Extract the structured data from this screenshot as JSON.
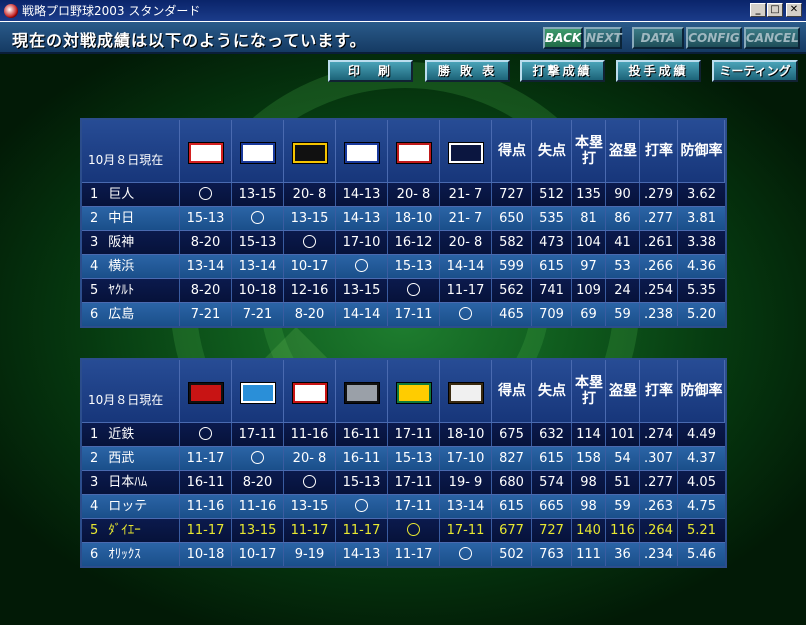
{
  "window": {
    "title": "戦略プロ野球2003 スタンダード"
  },
  "header": {
    "message": "現在の対戦成績は以下のようになっています。",
    "nav": {
      "back": "BACK",
      "next": "NEXT",
      "data": "DATA",
      "config": "CONFIG",
      "cancel": "CANCEL"
    }
  },
  "commands": {
    "print": "印　刷",
    "wins_losses": "勝 敗 表",
    "batting": "打撃成績",
    "pitching": "投手成績",
    "meeting": "ミーティング"
  },
  "stat_headers": [
    "得点",
    "失点",
    "本塁打",
    "盗塁",
    "打率",
    "防御率"
  ],
  "central": {
    "date_label": "10月８日現在",
    "teams": [
      {
        "rank": "1",
        "name": "巨人",
        "vs": [
          "",
          "13-15",
          "20- 8",
          "14-13",
          "20- 8",
          "21- 7"
        ],
        "runs": "727",
        "allowed": "512",
        "hr": "135",
        "sb": "90",
        "avg": ".279",
        "era": "3.62"
      },
      {
        "rank": "2",
        "name": "中日",
        "vs": [
          "15-13",
          "",
          "13-15",
          "14-13",
          "18-10",
          "21- 7"
        ],
        "runs": "650",
        "allowed": "535",
        "hr": "81",
        "sb": "86",
        "avg": ".277",
        "era": "3.81"
      },
      {
        "rank": "3",
        "name": "阪神",
        "vs": [
          "8-20",
          "15-13",
          "",
          "17-10",
          "16-12",
          "20- 8"
        ],
        "runs": "582",
        "allowed": "473",
        "hr": "104",
        "sb": "41",
        "avg": ".261",
        "era": "3.38"
      },
      {
        "rank": "4",
        "name": "横浜",
        "vs": [
          "13-14",
          "13-14",
          "10-17",
          "",
          "15-13",
          "14-14"
        ],
        "runs": "599",
        "allowed": "615",
        "hr": "97",
        "sb": "53",
        "avg": ".266",
        "era": "4.36"
      },
      {
        "rank": "5",
        "name": "ﾔｸﾙﾄ",
        "vs": [
          "8-20",
          "10-18",
          "12-16",
          "13-15",
          "",
          "11-17"
        ],
        "runs": "562",
        "allowed": "741",
        "hr": "109",
        "sb": "24",
        "avg": ".254",
        "era": "5.35"
      },
      {
        "rank": "6",
        "name": "広島",
        "vs": [
          "7-21",
          "7-21",
          "8-20",
          "14-14",
          "17-11",
          ""
        ],
        "runs": "465",
        "allowed": "709",
        "hr": "69",
        "sb": "59",
        "avg": ".238",
        "era": "5.20"
      }
    ],
    "logos": [
      {
        "icon": "giants-logo-icon",
        "bg": "#ffffff",
        "fg": "#d32020",
        "mark": "G"
      },
      {
        "icon": "dragons-logo-icon",
        "bg": "#ffffff",
        "fg": "#1a3a9c",
        "mark": "D"
      },
      {
        "icon": "tigers-logo-icon",
        "bg": "#111111",
        "fg": "#f5c400",
        "mark": "T"
      },
      {
        "icon": "baystars-logo-icon",
        "bg": "#ffffff",
        "fg": "#1a3a9c",
        "mark": "B"
      },
      {
        "icon": "swallows-logo-icon",
        "bg": "#ffffff",
        "fg": "#c01a1a",
        "mark": "S"
      },
      {
        "icon": "carp-logo-icon",
        "bg": "#0b1640",
        "fg": "#ffffff",
        "mark": "H"
      }
    ]
  },
  "pacific": {
    "date_label": "10月８日現在",
    "teams": [
      {
        "rank": "1",
        "name": "近鉄",
        "vs": [
          "",
          "17-11",
          "11-16",
          "16-11",
          "17-11",
          "18-10"
        ],
        "runs": "675",
        "allowed": "632",
        "hr": "114",
        "sb": "101",
        "avg": ".274",
        "era": "4.49",
        "highlight": false
      },
      {
        "rank": "2",
        "name": "西武",
        "vs": [
          "11-17",
          "",
          "20- 8",
          "16-11",
          "15-13",
          "17-10"
        ],
        "runs": "827",
        "allowed": "615",
        "hr": "158",
        "sb": "54",
        "avg": ".307",
        "era": "4.37",
        "highlight": false
      },
      {
        "rank": "3",
        "name": "日本ﾊﾑ",
        "vs": [
          "16-11",
          "8-20",
          "",
          "15-13",
          "17-11",
          "19- 9"
        ],
        "runs": "680",
        "allowed": "574",
        "hr": "98",
        "sb": "51",
        "avg": ".277",
        "era": "4.05",
        "highlight": false
      },
      {
        "rank": "4",
        "name": "ロッテ",
        "vs": [
          "11-16",
          "11-16",
          "13-15",
          "",
          "17-11",
          "13-14"
        ],
        "runs": "615",
        "allowed": "665",
        "hr": "98",
        "sb": "59",
        "avg": ".263",
        "era": "4.75",
        "highlight": false
      },
      {
        "rank": "5",
        "name": "ﾀﾞｲｴｰ",
        "vs": [
          "11-17",
          "13-15",
          "11-17",
          "11-17",
          "",
          "17-11"
        ],
        "runs": "677",
        "allowed": "727",
        "hr": "140",
        "sb": "116",
        "avg": ".264",
        "era": "5.21",
        "highlight": true
      },
      {
        "rank": "6",
        "name": "ｵﾘｯｸｽ",
        "vs": [
          "10-18",
          "10-17",
          "9-19",
          "14-13",
          "11-17",
          ""
        ],
        "runs": "502",
        "allowed": "763",
        "hr": "111",
        "sb": "36",
        "avg": ".234",
        "era": "5.46",
        "highlight": false
      }
    ],
    "logos": [
      {
        "icon": "buffaloes-logo-icon",
        "bg": "#c81414",
        "fg": "#111111",
        "mark": "B"
      },
      {
        "icon": "lions-logo-icon",
        "bg": "#2a8fd8",
        "fg": "#ffffff",
        "mark": "L"
      },
      {
        "icon": "fighters-logo-icon",
        "bg": "#ffffff",
        "fg": "#c81414",
        "mark": "F"
      },
      {
        "icon": "marines-logo-icon",
        "bg": "#9aa0a8",
        "fg": "#111111",
        "mark": "M"
      },
      {
        "icon": "hawks-logo-icon",
        "bg": "#ffcc00",
        "fg": "#117a3a",
        "mark": "D"
      },
      {
        "icon": "bluewave-logo-icon",
        "bg": "#f0f0f0",
        "fg": "#3a2a10",
        "mark": "B"
      }
    ]
  }
}
